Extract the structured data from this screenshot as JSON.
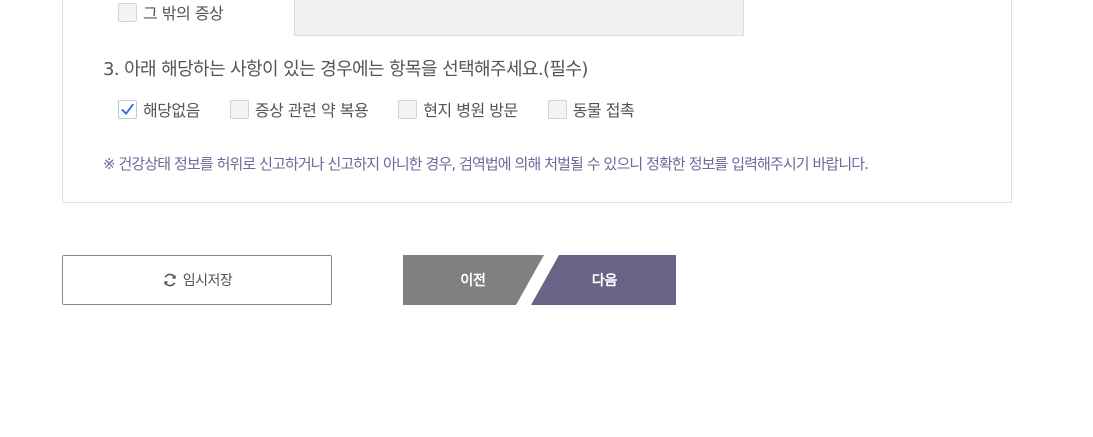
{
  "symptoms": {
    "other_label": "그 밖의 증상",
    "other_checked": false,
    "other_value": ""
  },
  "question3": {
    "title": "3. 아래 해당하는 사항이 있는 경우에는 항목을 선택해주세요.(필수)",
    "options": [
      {
        "label": "해당없음",
        "checked": true
      },
      {
        "label": "증상 관련 약 복용",
        "checked": false
      },
      {
        "label": "현지 병원 방문",
        "checked": false
      },
      {
        "label": "동물 접촉",
        "checked": false
      }
    ]
  },
  "notice": "※ 건강상태 정보를 허위로 신고하거나 신고하지 아니한 경우, 검역법에 의해 처벌될 수 있으니 정확한 정보를 입력해주시기 바랍니다.",
  "buttons": {
    "save_label": "임시저장",
    "save_icon": "refresh-icon",
    "prev_label": "이전",
    "next_label": "다음"
  },
  "colors": {
    "prev_bg": "#808080",
    "next_bg": "#676487",
    "notice_text": "#6b6a9a",
    "check_mark": "#3b6fd8"
  }
}
